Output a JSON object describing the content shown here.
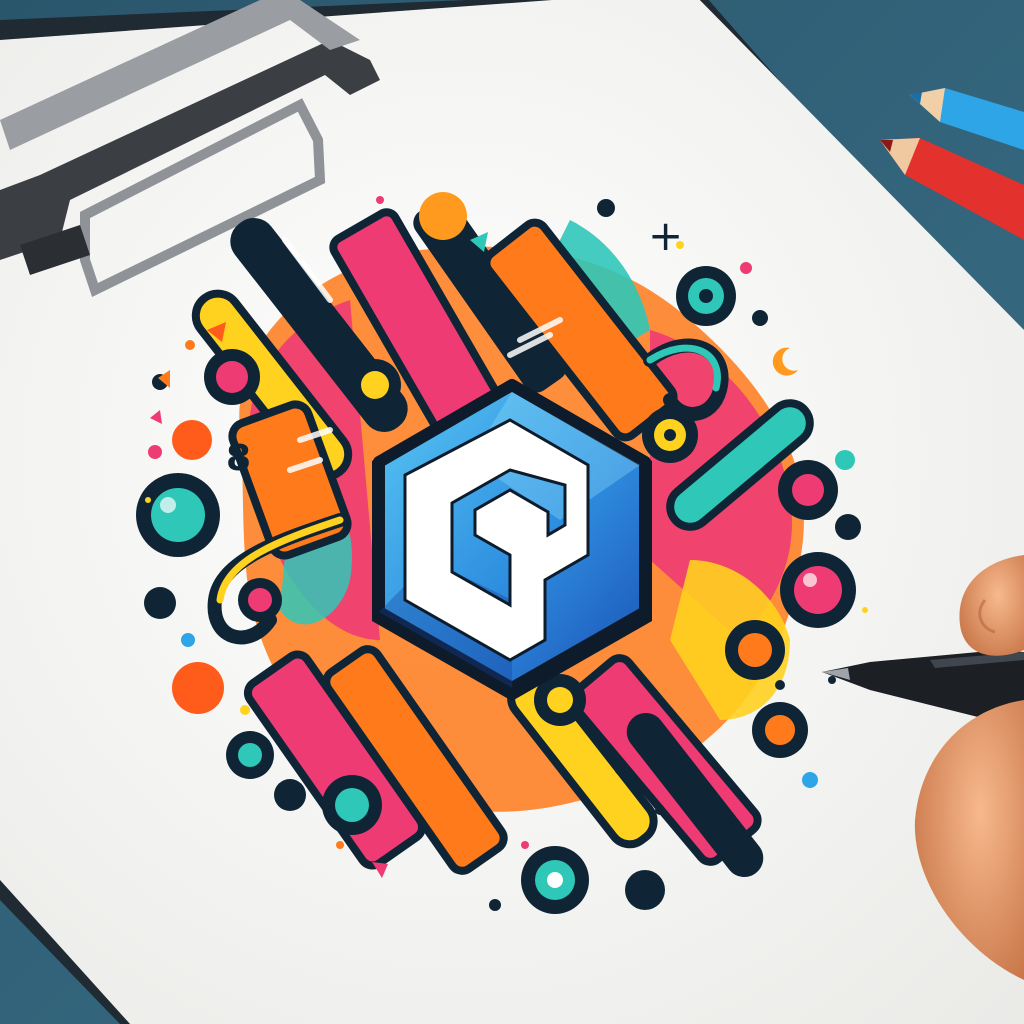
{
  "scene": {
    "description_colors": {
      "desk": "#2f5f76",
      "paper": "#f7f7f5",
      "clip": "#8a8a8a",
      "hex_light": "#49b6ec",
      "hex_dark": "#1e63c6",
      "hex_outline": "#0d1b2a",
      "logo_mark": "#ffffff",
      "pink": "#ee3b73",
      "orange": "#ff7a1a",
      "yellow": "#ffd21f",
      "teal": "#2fc7b8",
      "navy": "#0f2536",
      "red_pencil": "#e3312d",
      "blue_pencil": "#2ea5e6",
      "skin": "#f0a070"
    },
    "icons": {
      "logo": "hexagon-letter-mark-icon",
      "plus": "plus-icon",
      "eight": "digit-eight-glyph",
      "pen": "pen-icon",
      "pencils": "colored-pencils-icon"
    },
    "glyphs": {
      "plus": "+",
      "eight": "8"
    }
  }
}
